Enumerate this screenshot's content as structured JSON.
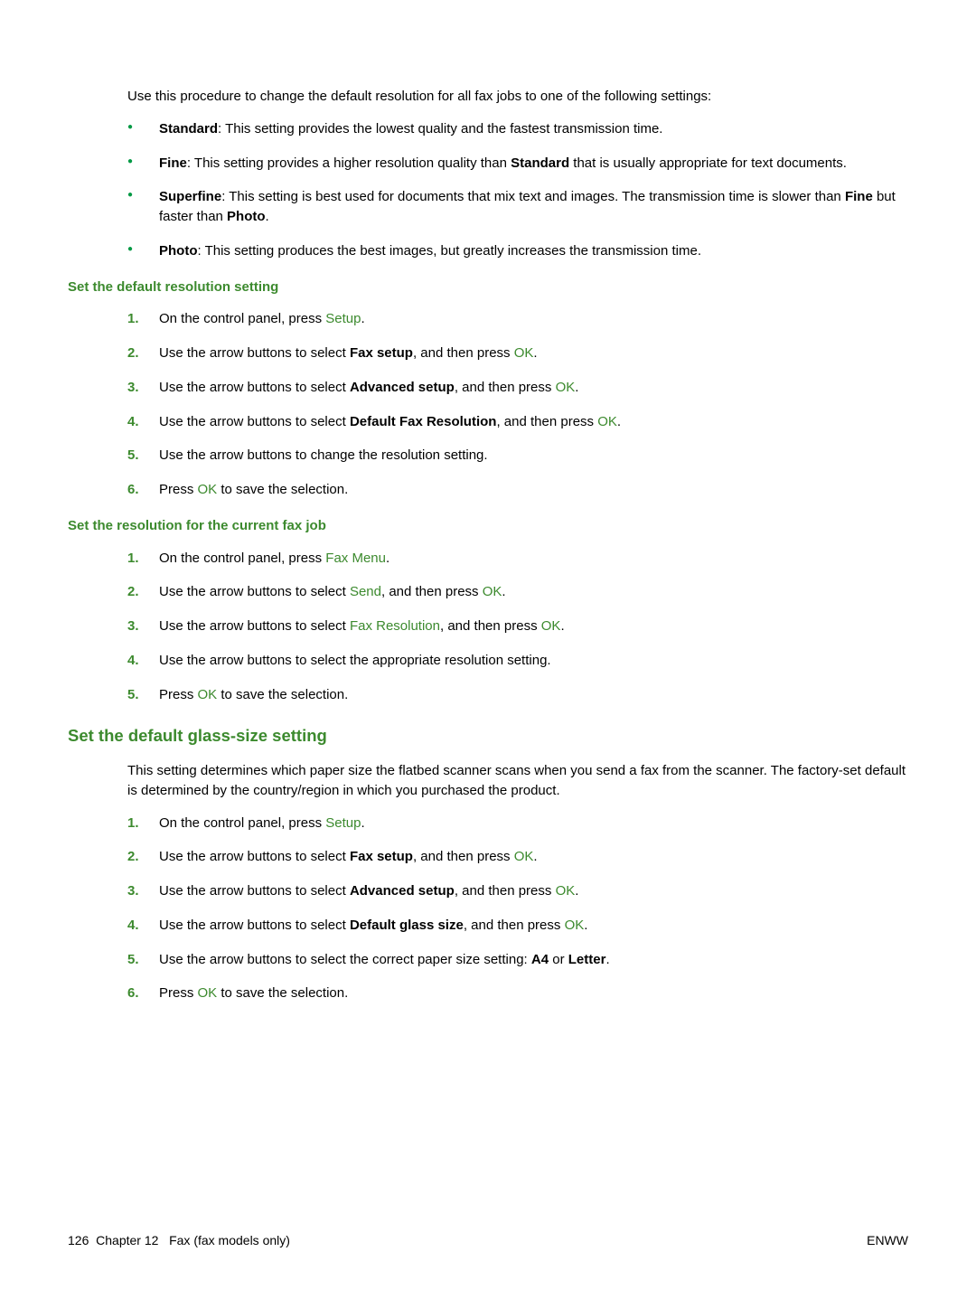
{
  "intro": "Use this procedure to change the default resolution for all fax jobs to one of the following settings:",
  "bullets": {
    "b1_bold": "Standard",
    "b1_rest": ": This setting provides the lowest quality and the fastest transmission time.",
    "b2_bold": "Fine",
    "b2_mid": ": This setting provides a higher resolution quality than ",
    "b2_bold2": "Standard",
    "b2_rest": " that is usually appropriate for text documents.",
    "b3_bold": "Superfine",
    "b3_mid": ": This setting is best used for documents that mix text and images. The transmission time is slower than ",
    "b3_bold2": "Fine",
    "b3_mid2": " but faster than ",
    "b3_bold3": "Photo",
    "b3_rest": ".",
    "b4_bold": "Photo",
    "b4_rest": ": This setting produces the best images, but greatly increases the transmission time."
  },
  "h4a": "Set the default resolution setting",
  "steps_a": {
    "s1_a": "On the control panel, press ",
    "s1_m": "Setup",
    "s1_b": ".",
    "s2_a": "Use the arrow buttons to select ",
    "s2_bold": "Fax setup",
    "s2_b": ", and then press ",
    "s2_m": "OK",
    "s2_c": ".",
    "s3_a": "Use the arrow buttons to select ",
    "s3_bold": "Advanced setup",
    "s3_b": ", and then press ",
    "s3_m": "OK",
    "s3_c": ".",
    "s4_a": "Use the arrow buttons to select ",
    "s4_bold": "Default Fax Resolution",
    "s4_b": ", and then press ",
    "s4_m": "OK",
    "s4_c": ".",
    "s5": "Use the arrow buttons to change the resolution setting.",
    "s6_a": "Press ",
    "s6_m": "OK",
    "s6_b": " to save the selection."
  },
  "h4b": "Set the resolution for the current fax job",
  "steps_b": {
    "s1_a": "On the control panel, press ",
    "s1_m": "Fax Menu",
    "s1_b": ".",
    "s2_a": "Use the arrow buttons to select ",
    "s2_m": "Send",
    "s2_b": ", and then press ",
    "s2_m2": "OK",
    "s2_c": ".",
    "s3_a": "Use the arrow buttons to select ",
    "s3_m": "Fax Resolution",
    "s3_b": ", and then press ",
    "s3_m2": "OK",
    "s3_c": ".",
    "s4": "Use the arrow buttons to select the appropriate resolution setting.",
    "s5_a": "Press ",
    "s5_m": "OK",
    "s5_b": " to save the selection."
  },
  "h3": "Set the default glass-size setting",
  "desc": "This setting determines which paper size the flatbed scanner scans when you send a fax from the scanner. The factory-set default is determined by the country/region in which you purchased the product.",
  "steps_c": {
    "s1_a": "On the control panel, press ",
    "s1_m": "Setup",
    "s1_b": ".",
    "s2_a": "Use the arrow buttons to select ",
    "s2_bold": "Fax setup",
    "s2_b": ", and then press ",
    "s2_m": "OK",
    "s2_c": ".",
    "s3_a": "Use the arrow buttons to select ",
    "s3_bold": "Advanced setup",
    "s3_b": ", and then press ",
    "s3_m": "OK",
    "s3_c": ".",
    "s4_a": "Use the arrow buttons to select ",
    "s4_bold": "Default glass size",
    "s4_b": ", and then press ",
    "s4_m": "OK",
    "s4_c": ".",
    "s5_a": "Use the arrow buttons to select the correct paper size setting: ",
    "s5_bold": "A4",
    "s5_b": " or ",
    "s5_bold2": "Letter",
    "s5_c": ".",
    "s6_a": "Press ",
    "s6_m": "OK",
    "s6_b": " to save the selection."
  },
  "footer": {
    "left_page": "126",
    "left_chapter": "Chapter 12",
    "left_title": "Fax (fax models only)",
    "right": "ENWW"
  }
}
